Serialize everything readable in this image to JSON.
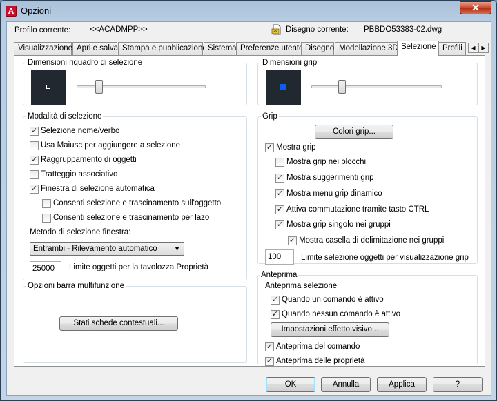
{
  "window": {
    "title": "Opzioni",
    "app_icon": "autocad-icon",
    "close_glyph": "✕"
  },
  "header": {
    "profile_label": "Profilo corrente:",
    "profile_value": "<<ACADMPP>>",
    "drawing_label": "Disegno corrente:",
    "drawing_value": "PBBDO53383-02.dwg",
    "drawing_icon": "drawing-file-icon"
  },
  "tabs": [
    {
      "label": "Visualizzazione",
      "active": false
    },
    {
      "label": "Apri e salva",
      "active": false
    },
    {
      "label": "Stampa e pubblicazione",
      "active": false
    },
    {
      "label": "Sistema",
      "active": false
    },
    {
      "label": "Preferenze utente",
      "active": false
    },
    {
      "label": "Disegno",
      "active": false
    },
    {
      "label": "Modellazione 3D",
      "active": false
    },
    {
      "label": "Selezione",
      "active": true
    },
    {
      "label": "Profili",
      "active": false
    }
  ],
  "tab_scroll": {
    "left": "◀",
    "right": "▶"
  },
  "pickbox": {
    "title": "Dimensioni riquadro di selezione",
    "preview_color": "#212830",
    "marker_color": "#ffffff"
  },
  "grip_size": {
    "title": "Dimensioni grip",
    "preview_color": "#212830",
    "marker_color": "#0a5ff0"
  },
  "selection_modes": {
    "title": "Modalità di selezione",
    "options": [
      {
        "label": "Selezione nome/verbo",
        "checked": true
      },
      {
        "label": "Usa Maiusc per aggiungere a selezione",
        "checked": false
      },
      {
        "label": "Raggruppamento di oggetti",
        "checked": true
      },
      {
        "label": "Tratteggio associativo",
        "checked": false
      },
      {
        "label": "Finestra di selezione automatica",
        "checked": true
      },
      {
        "label": "Consenti selezione e trascinamento sull'oggetto",
        "checked": false
      },
      {
        "label": "Consenti selezione e trascinamento per lazo",
        "checked": false
      }
    ],
    "window_method_label": "Metodo di selezione finestra:",
    "window_method_value": "Entrambi - Rilevamento automatico",
    "object_limit_value": "25000",
    "object_limit_label": "Limite oggetti per la tavolozza Proprietà"
  },
  "ribbon_options": {
    "title": "Opzioni barra multifunzione",
    "contextual_button": "Stati schede contestuali..."
  },
  "grips": {
    "title": "Grip",
    "colors_button": "Colori grip...",
    "options": [
      {
        "label": "Mostra grip",
        "checked": true
      },
      {
        "label": "Mostra grip nei blocchi",
        "checked": false
      },
      {
        "label": "Mostra suggerimenti grip",
        "checked": true
      },
      {
        "label": "Mostra menu grip dinamico",
        "checked": true
      },
      {
        "label": "Attiva commutazione tramite tasto CTRL",
        "checked": true
      },
      {
        "label": "Mostra grip singolo nei gruppi",
        "checked": true
      },
      {
        "label": "Mostra casella di delimitazione nei gruppi",
        "checked": true
      }
    ],
    "limit_value": "100",
    "limit_label": "Limite selezione oggetti per visualizzazione grip"
  },
  "preview": {
    "title": "Anteprima",
    "selection_preview_label": "Anteprima selezione",
    "options": [
      {
        "label": "Quando un comando è attivo",
        "checked": true
      },
      {
        "label": "Quando nessun comando è attivo",
        "checked": true
      }
    ],
    "visual_effects_button": "Impostazioni effetto visivo...",
    "extra_options": [
      {
        "label": "Anteprima del comando",
        "checked": true
      },
      {
        "label": "Anteprima delle proprietà",
        "checked": true
      }
    ]
  },
  "footer": {
    "ok": "OK",
    "cancel": "Annulla",
    "apply": "Applica",
    "help": "?"
  },
  "check_glyph": "✓"
}
